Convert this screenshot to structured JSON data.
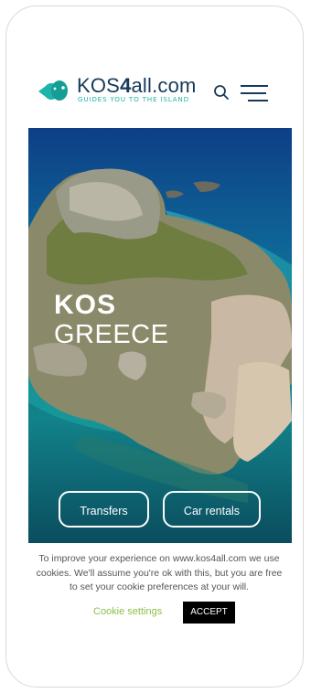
{
  "brand": {
    "name_prefix": "KOS",
    "name_four": "4",
    "name_suffix": "all.com",
    "tagline": "GUIDES YOU TO THE ISLAND"
  },
  "header": {
    "search_icon": "search-icon",
    "menu_icon": "hamburger-menu-icon"
  },
  "hero": {
    "title_line1": "KOS",
    "title_line2": "GREECE",
    "buttons": [
      {
        "label": "Transfers"
      },
      {
        "label": "Car rentals"
      }
    ]
  },
  "cookie": {
    "message": "To improve your experience on www.kos4all.com we use cookies. We'll assume you're ok with this, but you are free to set your cookie preferences at your will.",
    "settings_label": "Cookie settings",
    "accept_label": "ACCEPT"
  },
  "colors": {
    "brand_dark": "#173a5a",
    "brand_teal": "#1fb3a9",
    "cookie_link": "#8fbf4a"
  }
}
